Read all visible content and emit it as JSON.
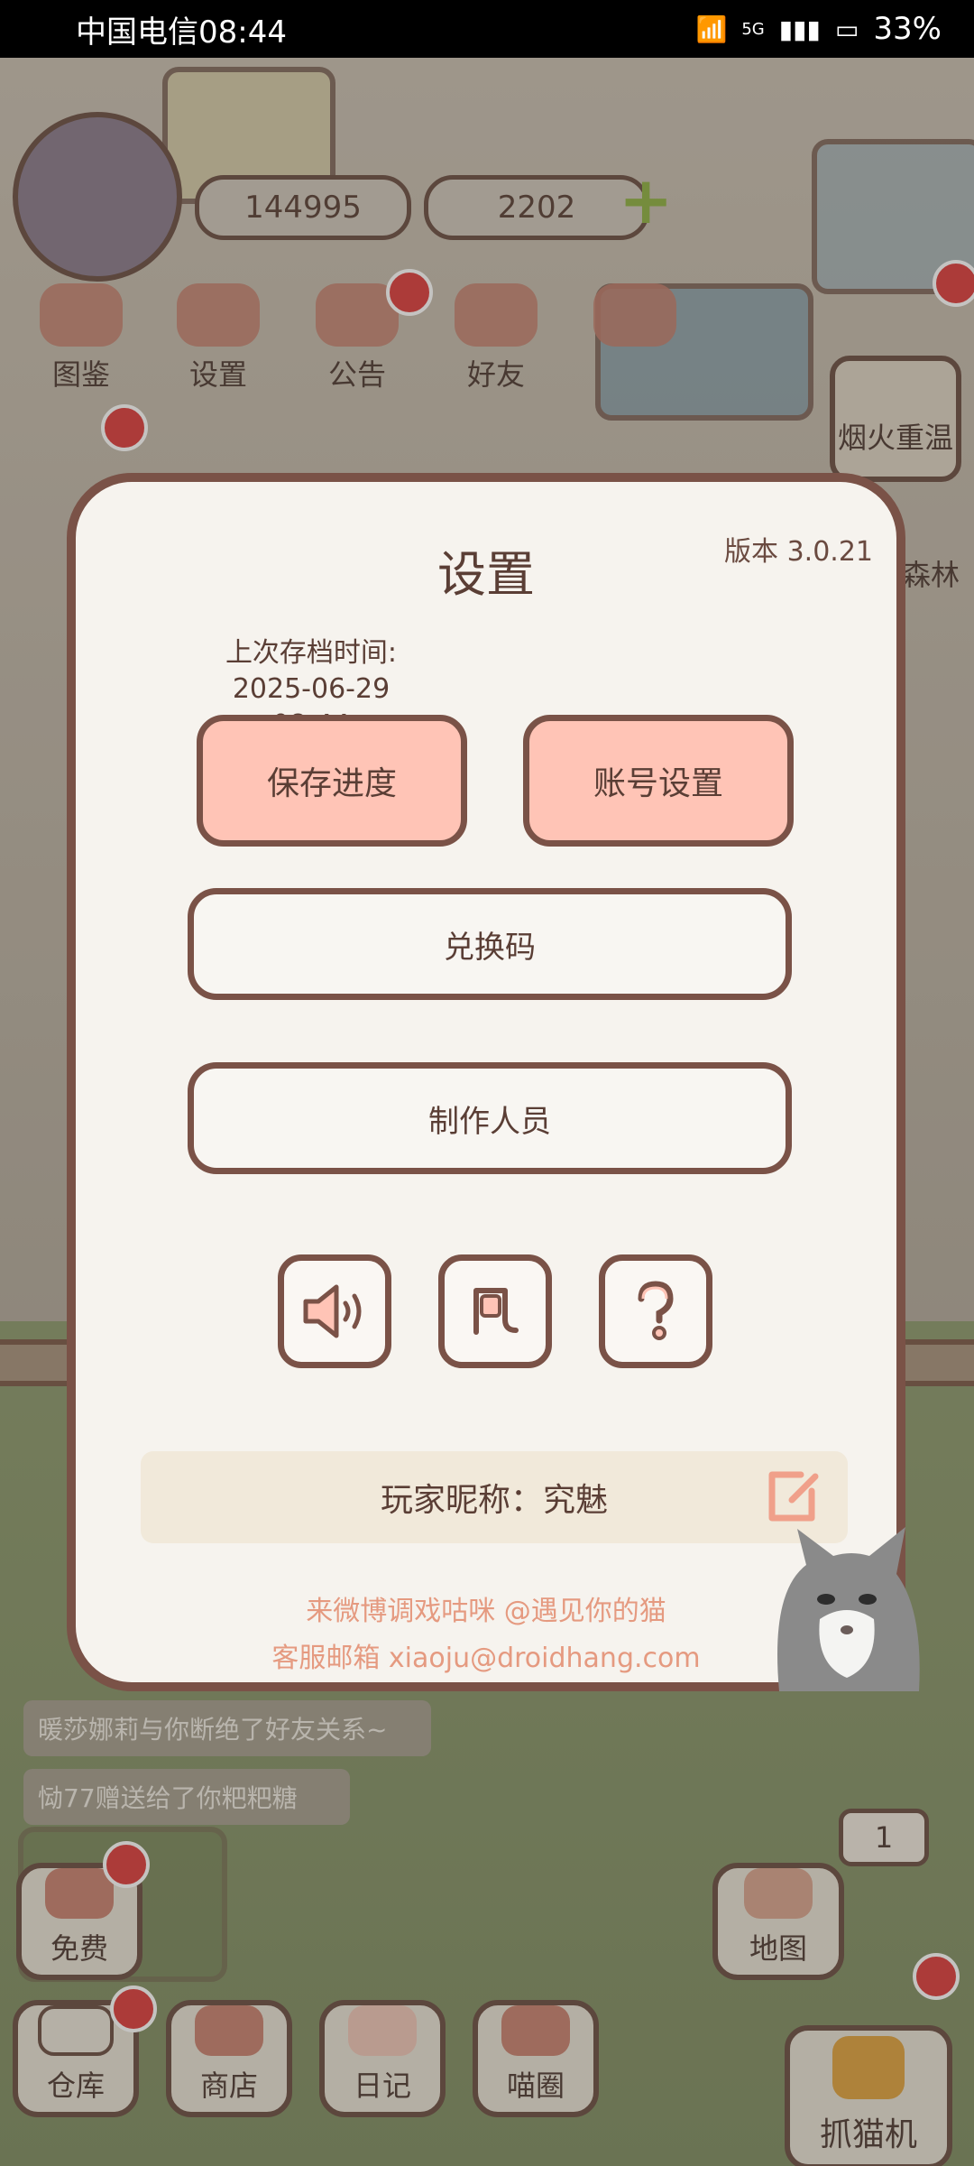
{
  "status_bar": {
    "carrier_time": "中国电信08:44",
    "network": "5G",
    "battery": "33%"
  },
  "top": {
    "fish_count": "144995",
    "heart_count": "2202",
    "plus": "+",
    "nav": [
      "图鉴",
      "设置",
      "公告",
      "好友"
    ],
    "right_item": "烟火重温",
    "side_partial": "森林"
  },
  "chat": [
    "暖莎娜莉与你断绝了好友关系~",
    "恸77赠送给了你粑粑糖"
  ],
  "bottom": {
    "free": "免费",
    "warehouse": "仓库",
    "shop": "商店",
    "diary": "日记",
    "circle": "喵圈",
    "map": "地图",
    "counter": "1",
    "claw_machine": "抓猫机"
  },
  "dialog": {
    "title": "设置",
    "version": "版本 3.0.21",
    "save_time_label": "上次存档时间:",
    "save_time_value": "2025-06-29 08:44",
    "save_button": "保存进度",
    "account_button": "账号设置",
    "redeem_button": "兑换码",
    "credits_button": "制作人员",
    "nickname": "玩家昵称：究魅",
    "weibo_text": "来微博调戏咕咪 @遇见你的猫",
    "email_text": "客服邮箱 xiaoju@droidhang.com"
  },
  "colors": {
    "accent_pink": "#ffc4b6",
    "border_brown": "#7a5247",
    "footer_orange": "#e59a80",
    "badge_red": "#dd3d3d"
  },
  "icons": [
    "sound-icon",
    "music-icon",
    "help-icon",
    "edit-icon"
  ]
}
